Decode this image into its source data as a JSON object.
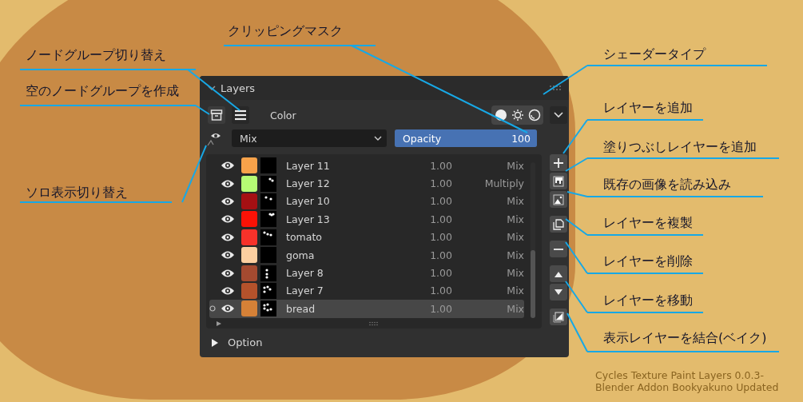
{
  "panel": {
    "title": "Layers",
    "node_label": "Color",
    "blend_mode": "Mix",
    "opacity": {
      "label": "Opacity",
      "value": "100",
      "level": 1.0
    },
    "layers": [
      {
        "name": "Layer 11",
        "color": "#f7a24a",
        "opacity": "1.00",
        "blend": "Mix",
        "visible": true,
        "selected": false
      },
      {
        "name": "Layer 12",
        "color": "#b6fb74",
        "opacity": "1.00",
        "blend": "Multiply",
        "visible": true,
        "selected": false
      },
      {
        "name": "Layer 10",
        "color": "#a51013",
        "opacity": "1.00",
        "blend": "Mix",
        "visible": true,
        "selected": false
      },
      {
        "name": "Layer 13",
        "color": "#fb1206",
        "opacity": "1.00",
        "blend": "Mix",
        "visible": true,
        "selected": false
      },
      {
        "name": "tomato",
        "color": "#f8322a",
        "opacity": "1.00",
        "blend": "Mix",
        "visible": true,
        "selected": false
      },
      {
        "name": "goma",
        "color": "#fccfa0",
        "opacity": "1.00",
        "blend": "Mix",
        "visible": true,
        "selected": false
      },
      {
        "name": "Layer 8",
        "color": "#a44a30",
        "opacity": "1.00",
        "blend": "Mix",
        "visible": true,
        "selected": false
      },
      {
        "name": "Layer 7",
        "color": "#b5522b",
        "opacity": "1.00",
        "blend": "Mix",
        "visible": true,
        "selected": false
      },
      {
        "name": "bread",
        "color": "#d58137",
        "opacity": "1.00",
        "blend": "Mix",
        "visible": true,
        "selected": true
      }
    ],
    "option": {
      "label": "Option",
      "expanded": false
    }
  },
  "annotations": [
    {
      "label": "クリッピングマスク"
    },
    {
      "label": "ノードグループ切り替え"
    },
    {
      "label": "空のノードグループを作成"
    },
    {
      "label": "ソロ表示切り替え"
    },
    {
      "label": "シェーダータイプ"
    },
    {
      "label": "レイヤーを追加"
    },
    {
      "label": "塗りつぶしレイヤーを追加"
    },
    {
      "label": "既存の画像を読み込み"
    },
    {
      "label": "レイヤーを複製"
    },
    {
      "label": "レイヤーを削除"
    },
    {
      "label": "レイヤーを移動"
    },
    {
      "label": "表示レイヤーを結合(ベイク)"
    }
  ],
  "caption": [
    "Cycles Texture Paint Layers 0.0.3-",
    "Blender Addon Bookyakuno Updated"
  ]
}
